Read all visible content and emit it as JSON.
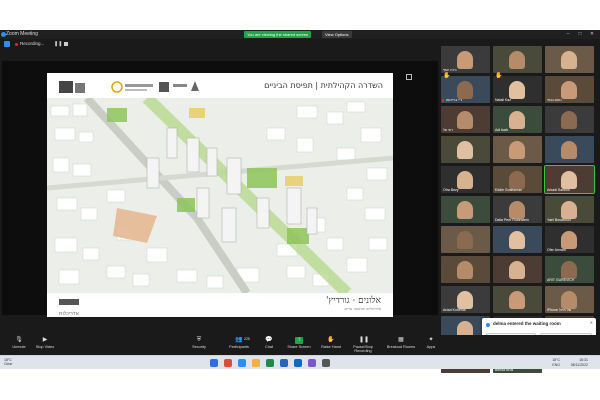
{
  "window": {
    "title": "Zoom Meeting"
  },
  "share_banner": {
    "label": "You are viewing the shared screen",
    "view_options": "View Options"
  },
  "recording": {
    "label": "Recording..."
  },
  "audio_notice": {
    "prefix": "Setup professional audio in ",
    "link": "Audio Settings"
  },
  "slide": {
    "title": "השדרה הקהילתית | תפיסת הביניים",
    "footer_right": "אלונים · גורדיץ'",
    "footer_right_sub": "אדריכלים ומתכנני ערים",
    "footer_left": "אדריכלות"
  },
  "gallery": {
    "tiles": [
      {
        "name": "נירה יוסף",
        "mic_off": false
      },
      {
        "name": "",
        "mic_off": false
      },
      {
        "name": "",
        "mic_off": false
      },
      {
        "name": "ג'יי ברייטמן",
        "mic_off": true
      },
      {
        "name": "Natali Kaz",
        "mic_off": false
      },
      {
        "name": "נחום גבאי",
        "mic_off": false
      },
      {
        "name": "רוני אל",
        "mic_off": false
      },
      {
        "name": "Adi barb",
        "mic_off": false
      },
      {
        "name": "",
        "mic_off": false
      },
      {
        "name": "",
        "mic_off": false
      },
      {
        "name": "",
        "mic_off": false
      },
      {
        "name": "",
        "mic_off": false
      },
      {
        "name": "Ofra Bezy",
        "mic_off": false
      },
      {
        "name": "Eddie Gottesman",
        "mic_off": false
      },
      {
        "name": "Arkadi Sankoo",
        "mic_off": false
      },
      {
        "name": "",
        "mic_off": false
      },
      {
        "name": "Dalia Peer Rubinstein",
        "mic_off": false
      },
      {
        "name": "Yael Bonamoor",
        "mic_off": false
      },
      {
        "name": "",
        "mic_off": false
      },
      {
        "name": "",
        "mic_off": false
      },
      {
        "name": "Ofer Amram",
        "mic_off": false
      },
      {
        "name": "",
        "mic_off": false
      },
      {
        "name": "",
        "mic_off": false
      },
      {
        "name": "ARIT GUREVICH",
        "mic_off": false
      },
      {
        "name": "Aviad Kohenia",
        "mic_off": false
      },
      {
        "name": "",
        "mic_off": false
      },
      {
        "name": "iPhone של מיכל",
        "mic_off": false
      },
      {
        "name": "Malka Gilt",
        "mic_off": false
      },
      {
        "name": "Eti Dahan",
        "mic_off": false
      },
      {
        "name": "Morta Lehari",
        "mic_off": false
      },
      {
        "name": "",
        "mic_off": false
      },
      {
        "name": "Benda Bros",
        "mic_off": false
      }
    ]
  },
  "waiting_room": {
    "message": "delma entered the waiting room",
    "admit": "Admit",
    "view": "View"
  },
  "toolbar": {
    "items": [
      {
        "label": "Unmute",
        "icon": "microphone-icon"
      },
      {
        "label": "Stop Video",
        "icon": "video-camera-icon"
      },
      {
        "label": "Security",
        "icon": "shield-icon"
      },
      {
        "label": "Participants",
        "icon": "participants-icon",
        "count": "225"
      },
      {
        "label": "Chat",
        "icon": "chat-icon"
      },
      {
        "label": "Share Screen",
        "icon": "share-screen-icon"
      },
      {
        "label": "Raise Hand",
        "icon": "hand-icon"
      },
      {
        "label": "Pause/Stop Recording",
        "icon": "pause-icon"
      },
      {
        "label": "Breakout Rooms",
        "icon": "breakout-rooms-icon"
      },
      {
        "label": "Apps",
        "icon": "apps-icon"
      }
    ]
  },
  "taskbar": {
    "weather_temp": "18°C",
    "weather_desc": "Clear",
    "time": "18:31",
    "date": "08/11/2022",
    "temp_right": "18°C",
    "lang": "ENG"
  }
}
